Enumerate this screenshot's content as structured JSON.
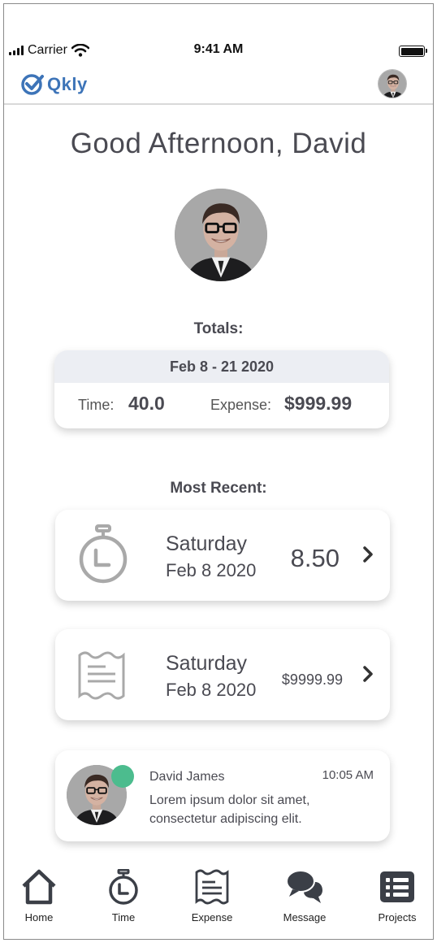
{
  "status_bar": {
    "carrier": "Carrier",
    "time": "9:41 AM"
  },
  "header": {
    "logo": "Qkly"
  },
  "greeting": "Good Afternoon, David",
  "totals": {
    "title": "Totals:",
    "period": "Feb 8 - 21 2020",
    "time_label": "Time:",
    "time_value": "40.0",
    "expense_label": "Expense:",
    "expense_value": "$999.99"
  },
  "recent": {
    "title": "Most Recent:",
    "items": [
      {
        "icon": "stopwatch-icon",
        "day": "Saturday",
        "date": "Feb 8 2020",
        "value": "8.50"
      },
      {
        "icon": "receipt-icon",
        "day": "Saturday",
        "date": "Feb 8 2020",
        "value": "$9999.99"
      }
    ]
  },
  "message": {
    "name": "David James",
    "time": "10:05 AM",
    "text": "Lorem ipsum dolor sit amet, consectetur adipiscing elit.",
    "status_color": "#4cbc8e"
  },
  "nav": [
    {
      "icon": "home-icon",
      "label": "Home"
    },
    {
      "icon": "stopwatch-icon",
      "label": "Time"
    },
    {
      "icon": "receipt-icon",
      "label": "Expense"
    },
    {
      "icon": "chat-icon",
      "label": "Message"
    },
    {
      "icon": "list-icon",
      "label": "Projects"
    }
  ],
  "colors": {
    "brand": "#3d74b8",
    "text": "#4a4a52",
    "online": "#4cbc8e",
    "period_bg": "#eceef3"
  }
}
